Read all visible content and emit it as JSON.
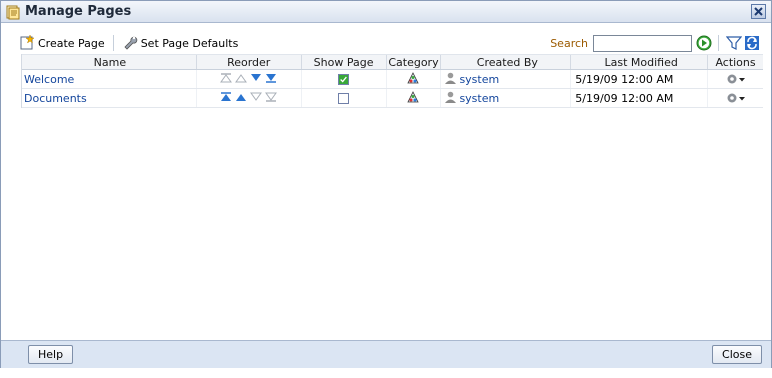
{
  "window": {
    "title": "Manage Pages",
    "title_icon": "pages-icon",
    "close_icon": "close-icon"
  },
  "toolbar": {
    "create_page_label": "Create Page",
    "set_defaults_label": "Set Page Defaults",
    "search_label": "Search",
    "search_value": "",
    "search_placeholder": ""
  },
  "columns": [
    "Name",
    "Reorder",
    "Show Page",
    "Category",
    "Created By",
    "Last Modified",
    "Actions"
  ],
  "rows": [
    {
      "name": "Welcome",
      "show_page": true,
      "created_by": "system",
      "last_modified": "5/19/09 12:00 AM"
    },
    {
      "name": "Documents",
      "show_page": false,
      "created_by": "system",
      "last_modified": "5/19/09 12:00 AM"
    }
  ],
  "footer": {
    "help_label": "Help",
    "close_label": "Close"
  },
  "colors": {
    "accent": "#13459c",
    "title_bg": "#d9e2ef",
    "footer_bg": "#dbe5f3",
    "search_label": "#9b5a00"
  }
}
